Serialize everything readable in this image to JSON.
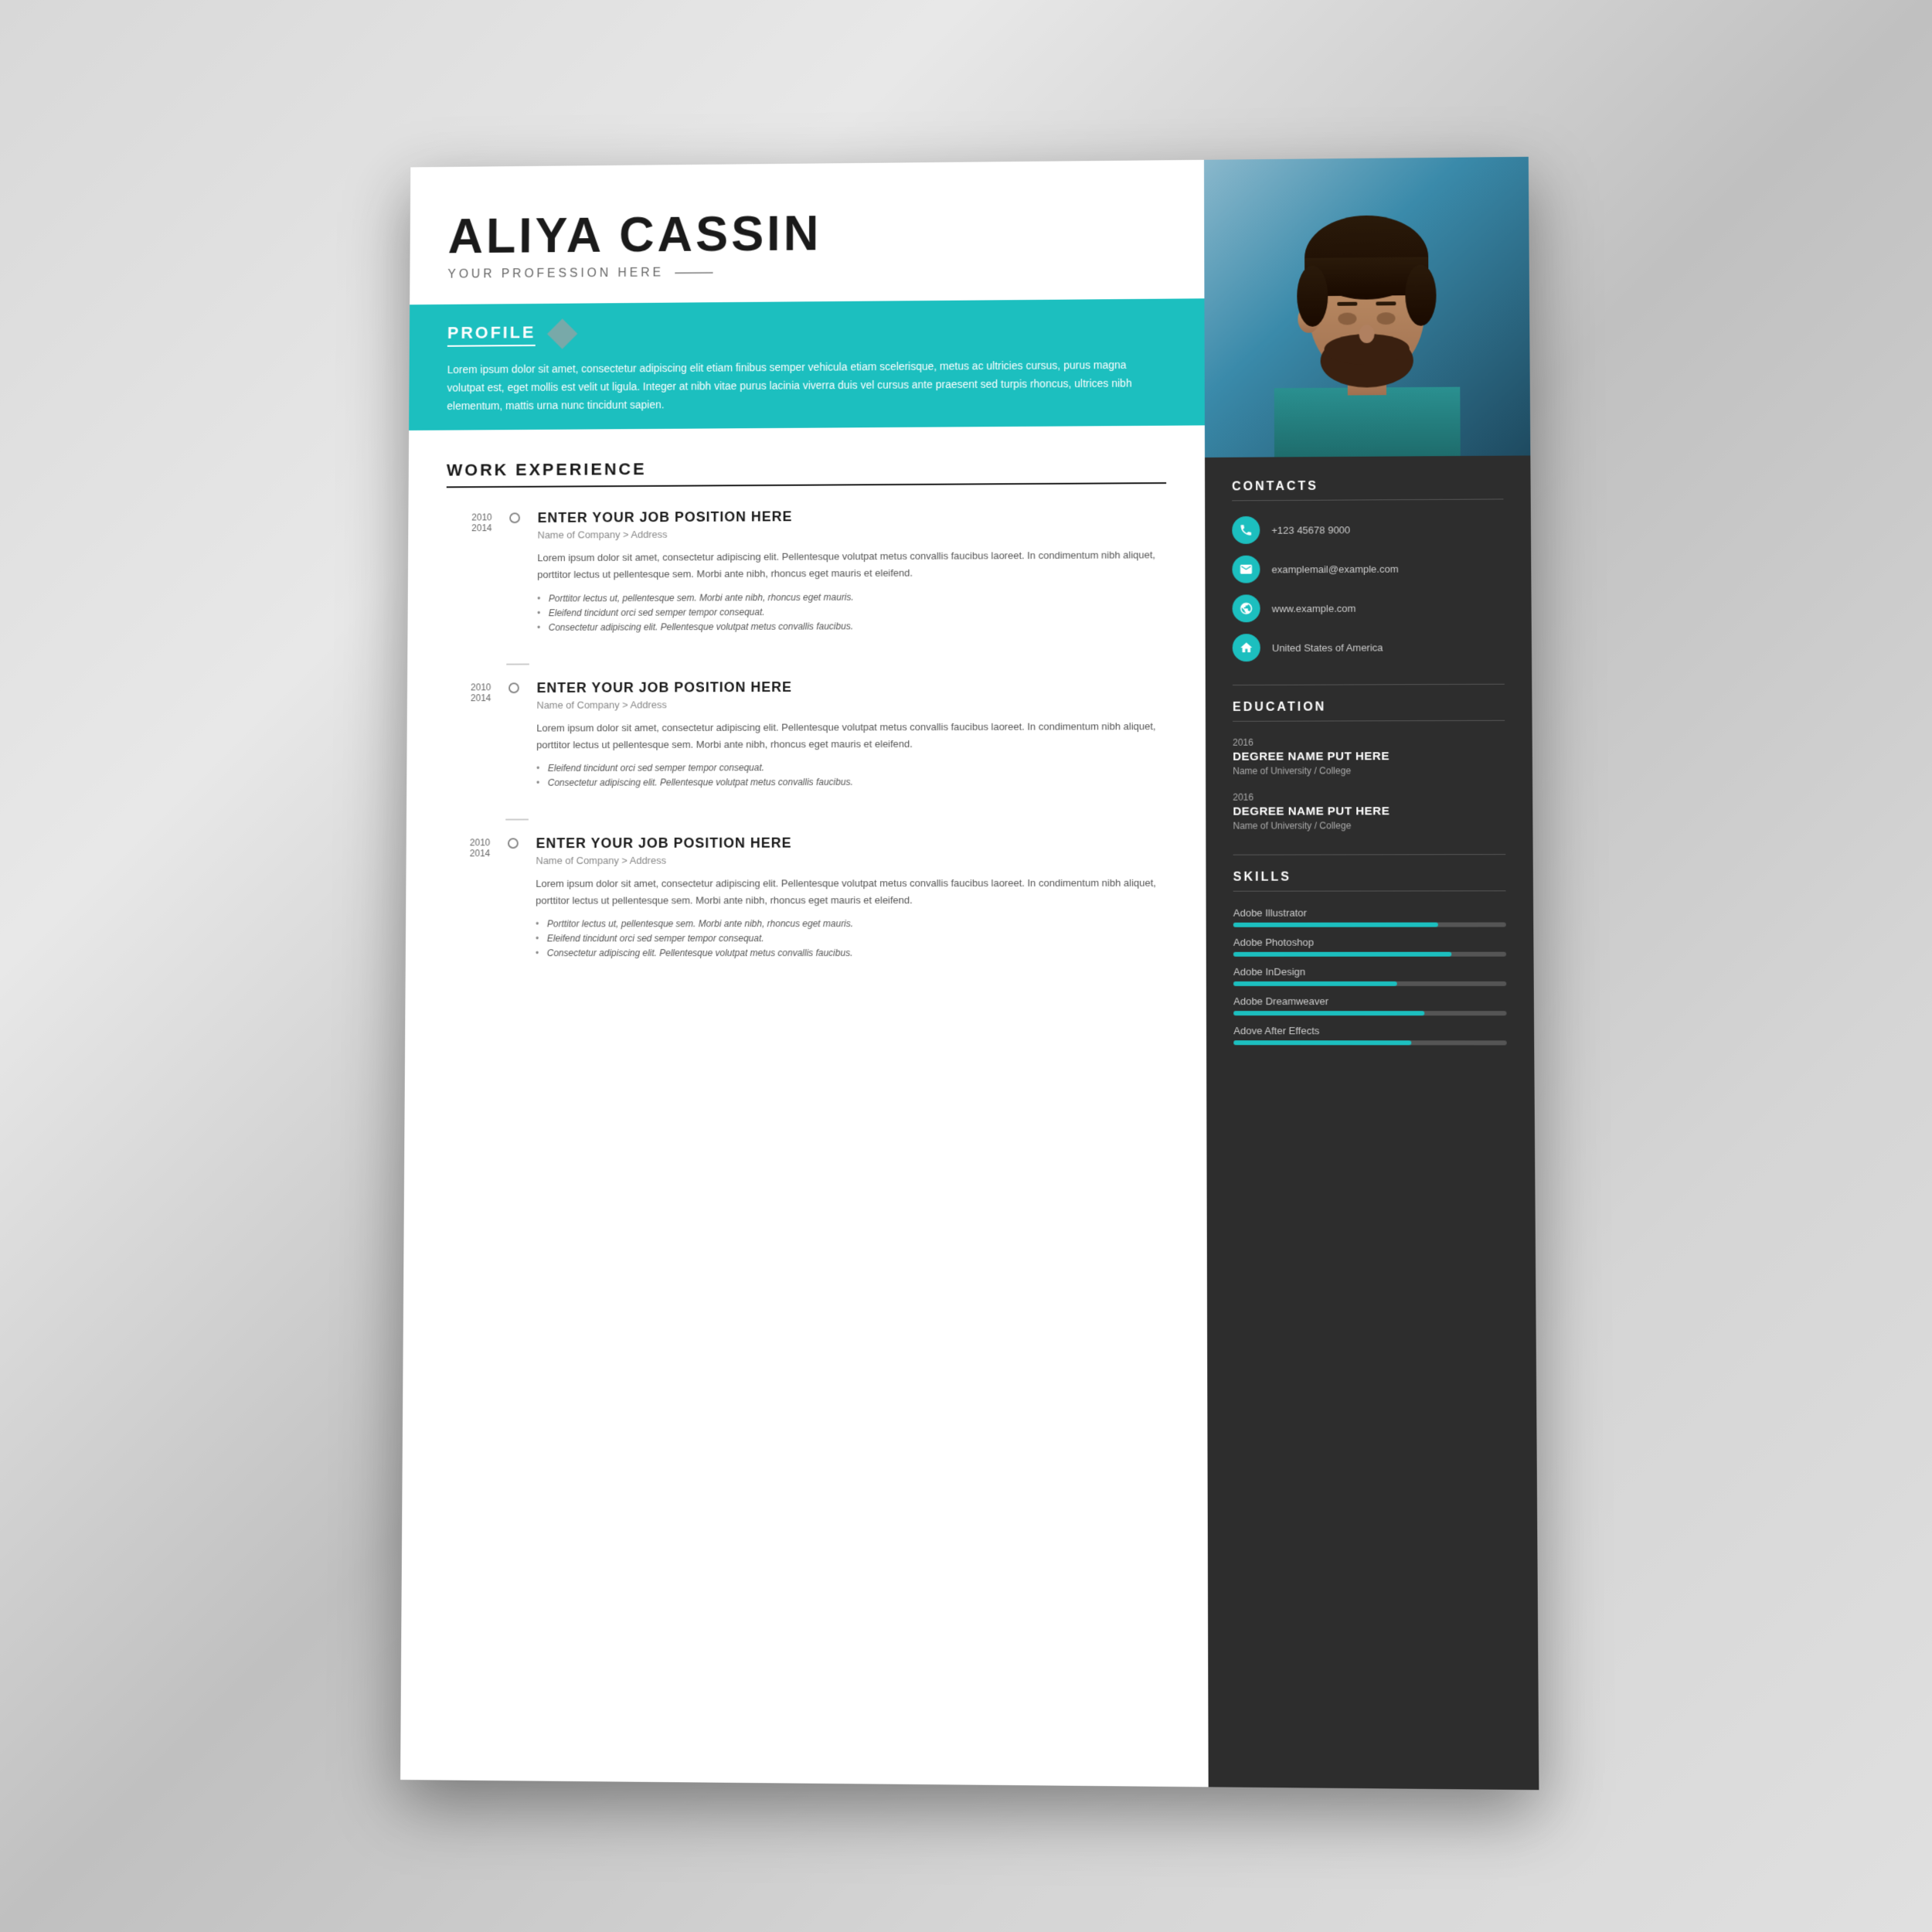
{
  "resume": {
    "name": "ALIYA CASSIN",
    "profession": "YOUR PROFESSION HERE",
    "profile": {
      "title": "PROFILE",
      "text": "Lorem ipsum dolor sit amet, consectetur adipiscing elit etiam finibus semper vehicula etiam scelerisque, metus ac ultricies cursus, purus magna volutpat est, eget mollis est velit ut ligula. Integer at nibh vitae purus lacinia viverra duis vel cursus ante praesent sed turpis rhoncus, ultrices nibh elementum, mattis urna nunc tincidunt sapien."
    },
    "work_experience": {
      "title": "WORK EXPERIENCE",
      "jobs": [
        {
          "year_start": "2010",
          "year_end": "2014",
          "position": "ENTER YOUR JOB POSITION HERE",
          "company": "Name of Company > Address",
          "description": "Lorem ipsum dolor sit amet, consectetur adipiscing elit. Pellentesque volutpat metus convallis faucibus laoreet. In condimentum nibh aliquet, porttitor lectus ut pellentesque sem. Morbi ante nibh, rhoncus eget mauris et eleifend.",
          "bullets": [
            "Porttitor lectus ut, pellentesque sem. Morbi ante nibh, rhoncus eget mauris.",
            "Eleifend tincidunt orci sed semper tempor consequat.",
            "Consectetur adipiscing elit. Pellentesque volutpat metus convallis faucibus."
          ]
        },
        {
          "year_start": "2010",
          "year_end": "2014",
          "position": "ENTER YOUR JOB POSITION HERE",
          "company": "Name of Company > Address",
          "description": "Lorem ipsum dolor sit amet, consectetur adipiscing elit. Pellentesque volutpat metus convallis faucibus laoreet. In condimentum nibh aliquet, porttitor lectus ut pellentesque sem. Morbi ante nibh, rhoncus eget mauris et eleifend.",
          "bullets": [
            "Eleifend tincidunt orci sed semper tempor consequat.",
            "Consectetur adipiscing elit. Pellentesque volutpat metus convallis faucibus."
          ]
        },
        {
          "year_start": "2010",
          "year_end": "2014",
          "position": "ENTER YOUR JOB POSITION HERE",
          "company": "Name of Company > Address",
          "description": "Lorem ipsum dolor sit amet, consectetur adipiscing elit. Pellentesque volutpat metus convallis faucibus laoreet. In condimentum nibh aliquet, porttitor lectus ut pellentesque sem. Morbi ante nibh, rhoncus eget mauris et eleifend.",
          "bullets": [
            "Porttitor lectus ut, pellentesque sem. Morbi ante nibh, rhoncus eget mauris.",
            "Eleifend tincidunt orci sed semper tempor consequat.",
            "Consectetur adipiscing elit. Pellentesque volutpat metus convallis faucibus."
          ]
        }
      ]
    },
    "contacts": {
      "title": "CONTACTS",
      "items": [
        {
          "icon": "📱",
          "type": "phone",
          "value": "+123 45678 9000"
        },
        {
          "icon": "✉",
          "type": "email",
          "value": "examplemail@example.com"
        },
        {
          "icon": "🌐",
          "type": "website",
          "value": "www.example.com"
        },
        {
          "icon": "🏠",
          "type": "location",
          "value": "United States of America"
        }
      ]
    },
    "education": {
      "title": "EDUCATION",
      "items": [
        {
          "year": "2016",
          "degree": "DEGREE NAME PUT HERE",
          "school": "Name of University / College"
        },
        {
          "year": "2016",
          "degree": "DEGREE NAME PUT HERE",
          "school": "Name of University / College"
        }
      ]
    },
    "skills": {
      "title": "SKILLS",
      "items": [
        {
          "name": "Adobe Illustrator",
          "level": 75
        },
        {
          "name": "Adobe Photoshop",
          "level": 80
        },
        {
          "name": "Adobe InDesign",
          "level": 60
        },
        {
          "name": "Adobe Dreamweaver",
          "level": 70
        },
        {
          "name": "Adove After Effects",
          "level": 65
        }
      ]
    }
  },
  "colors": {
    "teal": "#1cbfbf",
    "dark": "#2d2d2d",
    "white": "#ffffff"
  }
}
